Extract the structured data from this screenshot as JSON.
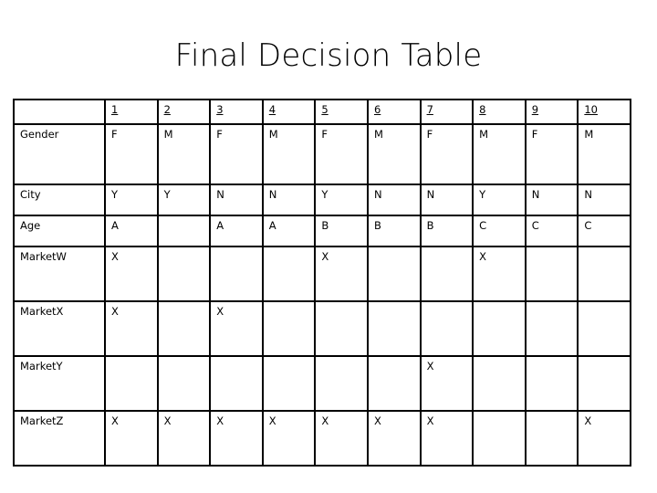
{
  "slide": {
    "title": "Final Decision Table"
  },
  "table": {
    "corner_label": "",
    "column_headers": [
      "1",
      "2",
      "3",
      "4",
      "5",
      "6",
      "7",
      "8",
      "9",
      "10"
    ],
    "rows": [
      {
        "label": "Gender",
        "size": "gender",
        "values": [
          "F",
          "M",
          "F",
          "M",
          "F",
          "M",
          "F",
          "M",
          "F",
          "M"
        ]
      },
      {
        "label": "City",
        "size": "short",
        "values": [
          "Y",
          "Y",
          "N",
          "N",
          "Y",
          "N",
          "N",
          "Y",
          "N",
          "N"
        ]
      },
      {
        "label": "Age",
        "size": "short",
        "values": [
          "A",
          "",
          "A",
          "A",
          "B",
          "B",
          "B",
          "C",
          "C",
          "C"
        ]
      },
      {
        "label": "MarketW",
        "size": "tall",
        "values": [
          "X",
          "",
          "",
          "",
          "X",
          "",
          "",
          "X",
          "",
          ""
        ]
      },
      {
        "label": "MarketX",
        "size": "tall",
        "values": [
          "X",
          "",
          "X",
          "",
          "",
          "",
          "",
          "",
          "",
          ""
        ]
      },
      {
        "label": "MarketY",
        "size": "tall",
        "values": [
          "",
          "",
          "",
          "",
          "",
          "",
          "X",
          "",
          "",
          ""
        ]
      },
      {
        "label": "MarketZ",
        "size": "tall",
        "values": [
          "X",
          "X",
          "X",
          "X",
          "X",
          "X",
          "X",
          "",
          "",
          "X"
        ]
      }
    ]
  },
  "colors": {
    "border": "#000000",
    "text": "#000000",
    "background": "#ffffff"
  }
}
